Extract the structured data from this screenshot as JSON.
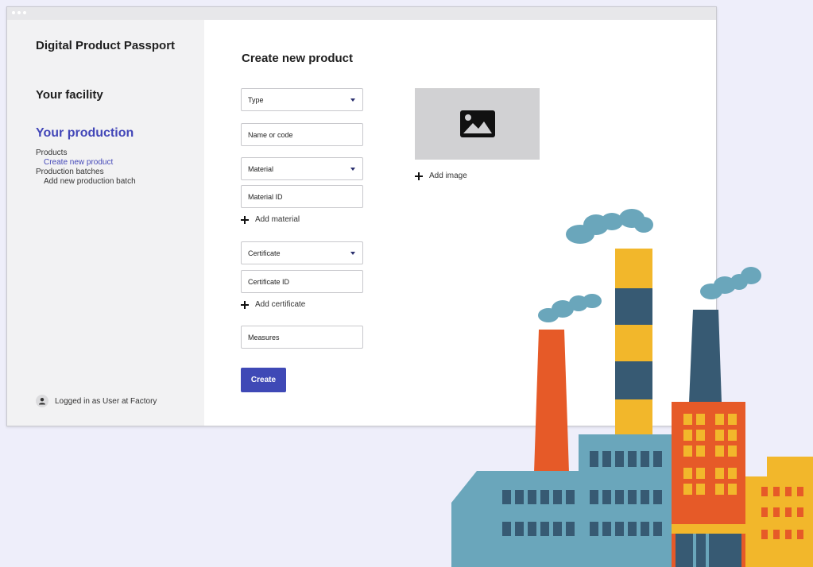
{
  "window": {
    "dots": 3
  },
  "sidebar": {
    "brand": "Digital Product Passport",
    "facility": "Your facility",
    "production": "Your production",
    "items": [
      {
        "label": "Products"
      },
      {
        "label": "Create new product",
        "active": true
      },
      {
        "label": "Production batches"
      },
      {
        "label": "Add new production batch"
      }
    ],
    "user": "Logged in as User at Factory"
  },
  "form": {
    "title": "Create new product",
    "type_select": "Type",
    "name_field": "Name or code",
    "material_select": "Material",
    "material_id_field": "Material ID",
    "add_material": "Add material",
    "certificate_select": "Certificate",
    "certificate_id_field": "Certificate ID",
    "add_certificate": "Add certificate",
    "measures_field": "Measures",
    "create_button": "Create",
    "add_image": "Add image"
  },
  "colors": {
    "accent": "#4347b8",
    "button": "#3f49b6",
    "background": "#eeeefa",
    "sidebar": "#f2f2f3",
    "factory_orange": "#e65a28",
    "factory_yellow": "#f2b72b",
    "factory_teal": "#6aa6bb",
    "factory_navy": "#375a73"
  },
  "icons": {
    "image_placeholder": "image-icon",
    "user": "user-icon",
    "add": "plus-icon",
    "dropdown": "chevron-down-icon"
  }
}
